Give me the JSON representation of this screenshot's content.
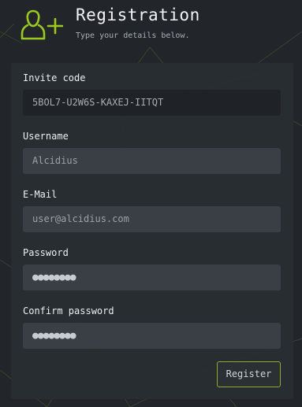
{
  "header": {
    "title": "Registration",
    "subtitle": "Type your details below.",
    "icon": "add-user-icon",
    "accent_color": "#9cc91f"
  },
  "form": {
    "invite_code": {
      "label": "Invite code",
      "value": "5BOL7-U2W6S-KAXEJ-IITQT"
    },
    "username": {
      "label": "Username",
      "placeholder": "Alcidius"
    },
    "email": {
      "label": "E-Mail",
      "placeholder": "user@alcidius.com"
    },
    "password": {
      "label": "Password",
      "value": "●●●●●●●●"
    },
    "confirm_password": {
      "label": "Confirm password",
      "value": "●●●●●●●●"
    },
    "submit_label": "Register",
    "submit_border_color": "#8cac2f"
  }
}
